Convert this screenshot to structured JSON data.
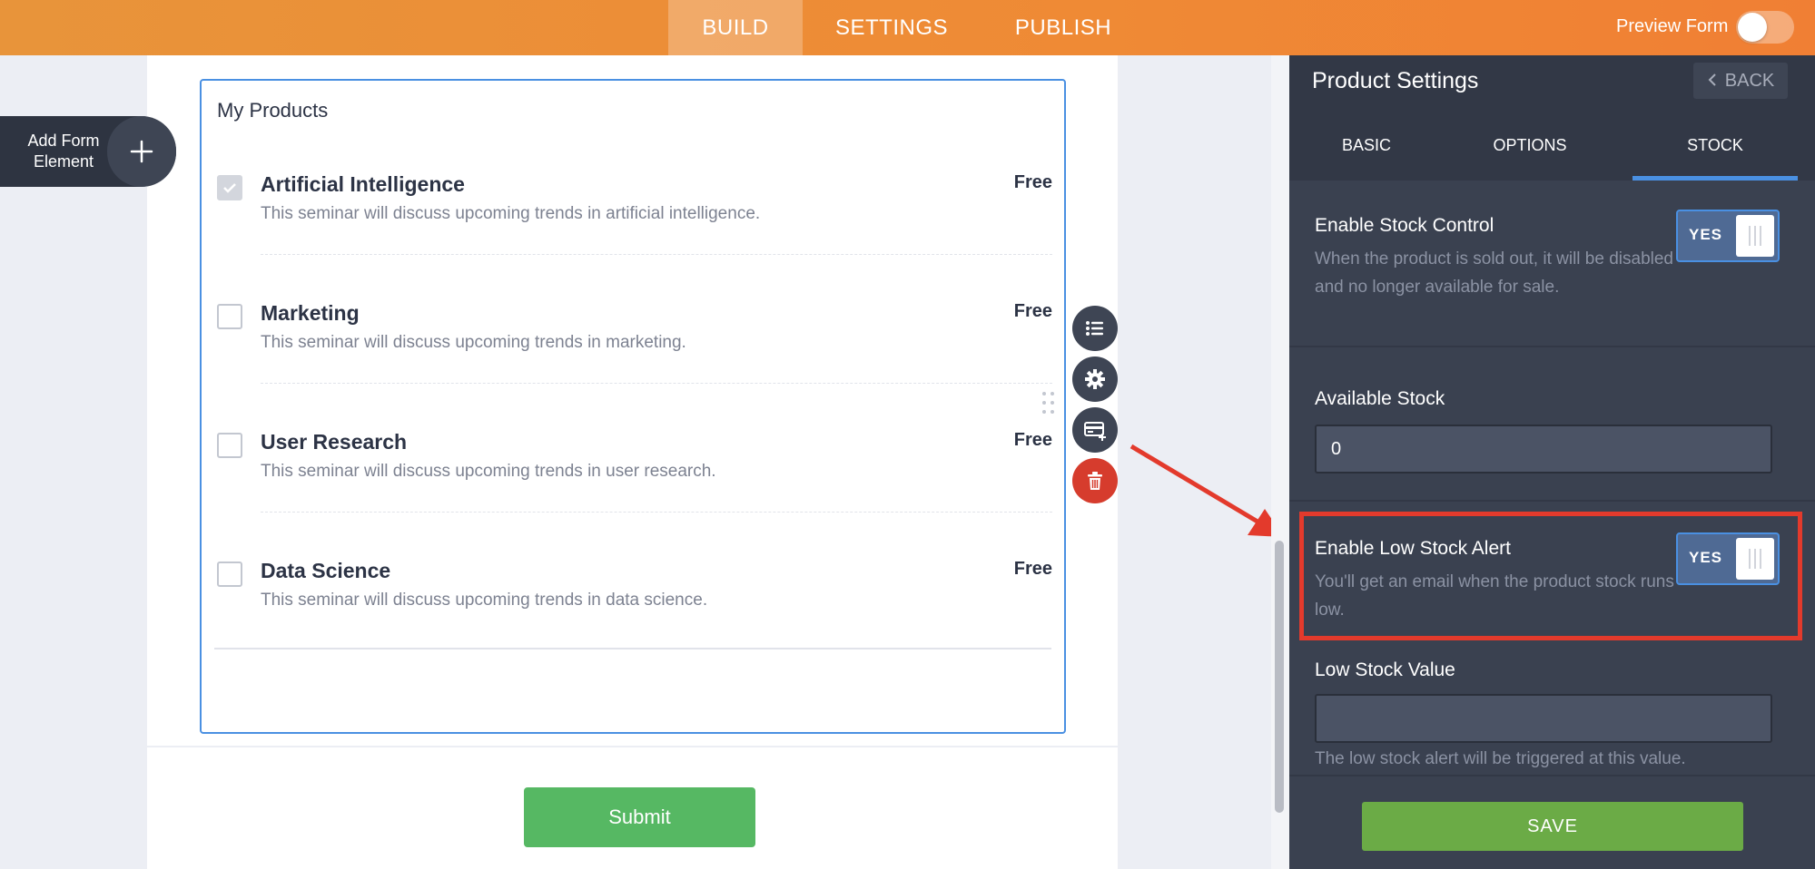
{
  "topbar": {
    "tabs": [
      "BUILD",
      "SETTINGS",
      "PUBLISH"
    ],
    "active_tab": "BUILD",
    "preview_label": "Preview Form"
  },
  "add_element": {
    "label": "Add Form Element"
  },
  "product_list": {
    "title": "My Products",
    "items": [
      {
        "name": "Artificial Intelligence",
        "description": "This seminar will discuss upcoming trends in artificial intelligence.",
        "price": "Free",
        "checked": true
      },
      {
        "name": "Marketing",
        "description": "This seminar will discuss upcoming trends in marketing.",
        "price": "Free",
        "checked": false
      },
      {
        "name": "User Research",
        "description": "This seminar will discuss upcoming trends in user research.",
        "price": "Free",
        "checked": false
      },
      {
        "name": "Data Science",
        "description": "This seminar will discuss upcoming trends in data science.",
        "price": "Free",
        "checked": false
      }
    ]
  },
  "submit_label": "Submit",
  "tools": [
    "list-icon",
    "gear-icon",
    "payment-card-icon",
    "trash-icon"
  ],
  "panel": {
    "title": "Product Settings",
    "back_label": "BACK",
    "tabs": [
      "BASIC",
      "OPTIONS",
      "STOCK"
    ],
    "active_tab": "STOCK",
    "enable_stock": {
      "title": "Enable Stock Control",
      "description": "When the product is sold out, it will be disabled and no longer available for sale.",
      "toggle_label": "YES"
    },
    "available_stock": {
      "title": "Available Stock",
      "value": "0"
    },
    "low_stock_alert": {
      "title": "Enable Low Stock Alert",
      "description": "You'll get an email when the product stock runs low.",
      "toggle_label": "YES"
    },
    "low_stock_value": {
      "title": "Low Stock Value",
      "value": "",
      "hint": "The low stock alert will be triggered at this value."
    },
    "save_label": "SAVE"
  },
  "colors": {
    "topbar": "#ef8a35",
    "panel": "#3a4150",
    "accent_blue": "#4a90e2",
    "submit_green": "#56b863",
    "save_green": "#6bab46",
    "annotation_red": "#e33a2c"
  }
}
